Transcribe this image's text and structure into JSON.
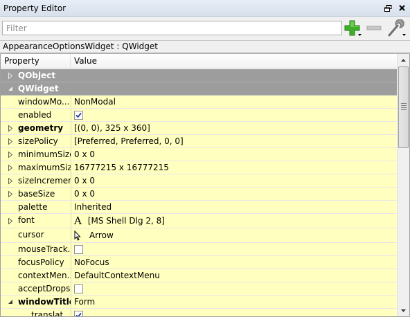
{
  "window": {
    "title": "Property Editor"
  },
  "toolbar": {
    "filter_placeholder": "Filter",
    "filter_value": "",
    "add_icon": "plus-icon",
    "remove_icon": "minus-icon",
    "configure_icon": "wrench-icon"
  },
  "class_label": "AppearanceOptionsWidget : QWidget",
  "header": {
    "property": "Property",
    "value": "Value"
  },
  "groups": {
    "qobject": "QObject",
    "qwidget": "QWidget"
  },
  "rows": [
    {
      "name": "windowMo...",
      "value": "NonModal"
    },
    {
      "name": "enabled",
      "checked": true
    },
    {
      "name": "geometry",
      "value": "[(0, 0), 325 x 360]"
    },
    {
      "name": "sizePolicy",
      "value": "[Preferred, Preferred, 0, 0]"
    },
    {
      "name": "minimumSize",
      "value": "0 x 0"
    },
    {
      "name": "maximumSize",
      "value": "16777215 x 16777215"
    },
    {
      "name": "sizeIncrement",
      "value": "0 x 0"
    },
    {
      "name": "baseSize",
      "value": "0 x 0"
    },
    {
      "name": "palette",
      "value": "Inherited"
    },
    {
      "name": "font",
      "icon_text": "A",
      "value": "[MS Shell Dlg 2, 8]"
    },
    {
      "name": "cursor",
      "value": "Arrow"
    },
    {
      "name": "mouseTrack...",
      "checked": false
    },
    {
      "name": "focusPolicy",
      "value": "NoFocus"
    },
    {
      "name": "contextMen...",
      "value": "DefaultContextMenu"
    },
    {
      "name": "acceptDrops",
      "checked": false
    },
    {
      "name": "windowTitle",
      "value": "Form"
    },
    {
      "name": "translat...",
      "checked": true
    }
  ],
  "colors": {
    "group_bg": "#9d9d9d",
    "row_bg": "#ffffc0",
    "accent_green": "#3fae29"
  }
}
